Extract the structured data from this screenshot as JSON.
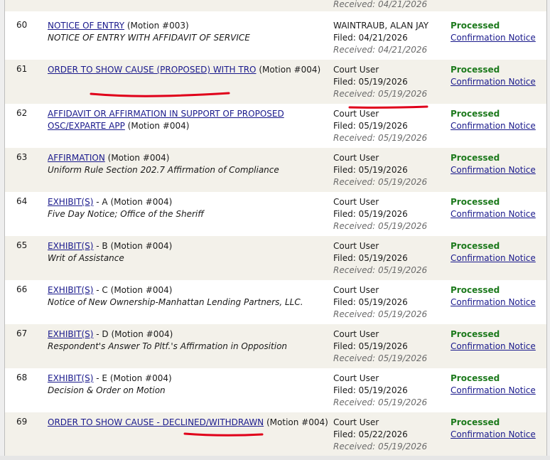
{
  "top_received": "Received: 04/21/2026",
  "entries": [
    {
      "num": "60",
      "link": "NOTICE OF ENTRY",
      "motion": "(Motion #003)",
      "suffix": "",
      "sub": "NOTICE OF ENTRY WITH AFFIDAVIT OF SERVICE",
      "filer": "WAINTRAUB, ALAN JAY",
      "filed": "Filed: 04/21/2026",
      "received": "Received: 04/21/2026",
      "status": "Processed",
      "notice": "Confirmation Notice"
    },
    {
      "num": "61",
      "link": "ORDER TO SHOW CAUSE (PROPOSED) WITH TRO",
      "motion": "(Motion #004)",
      "suffix": "",
      "sub": "",
      "filer": "Court User",
      "filed": "Filed: 05/19/2026",
      "received": "Received: 05/19/2026",
      "status": "Processed",
      "notice": "Confirmation Notice"
    },
    {
      "num": "62",
      "link": "AFFIDAVIT OR AFFIRMATION IN SUPPORT OF PROPOSED OSC/EXPARTE APP",
      "motion": "(Motion #004)",
      "suffix": "",
      "sub": "",
      "filer": "Court User",
      "filed": "Filed: 05/19/2026",
      "received": "Received: 05/19/2026",
      "status": "Processed",
      "notice": "Confirmation Notice"
    },
    {
      "num": "63",
      "link": "AFFIRMATION",
      "motion": "(Motion #004)",
      "suffix": "",
      "sub": "Uniform Rule Section 202.7 Affirmation of Compliance",
      "filer": "Court User",
      "filed": "Filed: 05/19/2026",
      "received": "Received: 05/19/2026",
      "status": "Processed",
      "notice": "Confirmation Notice"
    },
    {
      "num": "64",
      "link": "EXHIBIT(S)",
      "motion": "(Motion #004)",
      "suffix": "- A",
      "sub": "Five Day Notice; Office of the Sheriff",
      "filer": "Court User",
      "filed": "Filed: 05/19/2026",
      "received": "Received: 05/19/2026",
      "status": "Processed",
      "notice": "Confirmation Notice"
    },
    {
      "num": "65",
      "link": "EXHIBIT(S)",
      "motion": "(Motion #004)",
      "suffix": "- B",
      "sub": "Writ of Assistance",
      "filer": "Court User",
      "filed": "Filed: 05/19/2026",
      "received": "Received: 05/19/2026",
      "status": "Processed",
      "notice": "Confirmation Notice"
    },
    {
      "num": "66",
      "link": "EXHIBIT(S)",
      "motion": "(Motion #004)",
      "suffix": "- C",
      "sub": "Notice of New Ownership-Manhattan Lending Partners, LLC.",
      "filer": "Court User",
      "filed": "Filed: 05/19/2026",
      "received": "Received: 05/19/2026",
      "status": "Processed",
      "notice": "Confirmation Notice"
    },
    {
      "num": "67",
      "link": "EXHIBIT(S)",
      "motion": "(Motion #004)",
      "suffix": "- D",
      "sub": "Respondent's Answer To Pltf.'s Affirmation in Opposition",
      "filer": "Court User",
      "filed": "Filed: 05/19/2026",
      "received": "Received: 05/19/2026",
      "status": "Processed",
      "notice": "Confirmation Notice"
    },
    {
      "num": "68",
      "link": "EXHIBIT(S)",
      "motion": "(Motion #004)",
      "suffix": "- E",
      "sub": "Decision & Order on Motion",
      "filer": "Court User",
      "filed": "Filed: 05/19/2026",
      "received": "Received: 05/19/2026",
      "status": "Processed",
      "notice": "Confirmation Notice"
    },
    {
      "num": "69",
      "link": "ORDER TO SHOW CAUSE - DECLINED/WITHDRAWN",
      "motion": "(Motion #004)",
      "suffix": "",
      "sub": "",
      "filer": "Court User",
      "filed": "Filed: 05/22/2026",
      "received": "Received: 05/19/2026",
      "status": "Processed",
      "notice": "Confirmation Notice"
    }
  ],
  "colors": {
    "processed": "#1d7a1d",
    "link": "#1a1a8c",
    "annotation": "#e0001a",
    "row_alt": "#f3f1ea"
  }
}
